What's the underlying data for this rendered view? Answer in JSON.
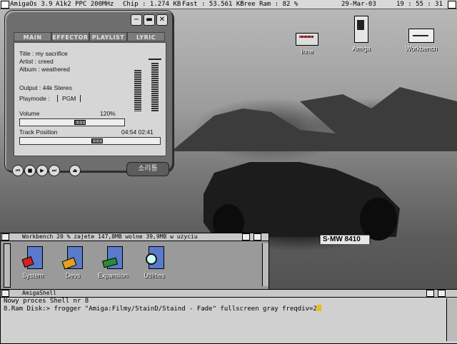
{
  "topbar": {
    "os": "AmigaOs 3.9",
    "cpu": "A1k2 PPC 200MHz",
    "chip": "Chip : 1.274 KB",
    "fast": "Fast : 53.561 KB",
    "freeram": "Free Ram : 82 %",
    "date": "29-Mar-03",
    "time": "19 : 55 : 31"
  },
  "desktop_icons": [
    {
      "label": "Inne",
      "icon": "drawer-icon"
    },
    {
      "label": "Amiga",
      "icon": "tower-icon"
    },
    {
      "label": "Workbench",
      "icon": "disk-drive-icon"
    }
  ],
  "player": {
    "tabs": [
      "MAIN",
      "EFFECTOR",
      "PLAYLIST",
      "LYRIC"
    ],
    "title_line": "Title   : my sacrifice",
    "artist_line": "Artist  : creed",
    "album_line": "Album : weathered",
    "output_line": "Output    : 44k Stereo",
    "playmode_label": "Playmode :",
    "playmode_value": "PGM",
    "volume_label": "Volume",
    "volume_value": "120%",
    "track_label": "Track Position",
    "track_time": "04:54 02:41",
    "logo_text": "소리통",
    "controls": [
      "prev",
      "stop",
      "play",
      "next",
      "eject"
    ]
  },
  "workbench": {
    "title": "Workbench  20 % zajete  147,8MB wolne  39,9MB w uzyciu",
    "icons": [
      "System",
      "Devs",
      "Expansion",
      "Utilities"
    ]
  },
  "shell": {
    "title": "AmigaShell",
    "line1": "Nowy proces Shell nr 8",
    "line2": "8.Ram Disk:> frogger \"Amiga:Filmy/StainD/Staind - Fade\" fullscreen gray freqdiv=2"
  }
}
